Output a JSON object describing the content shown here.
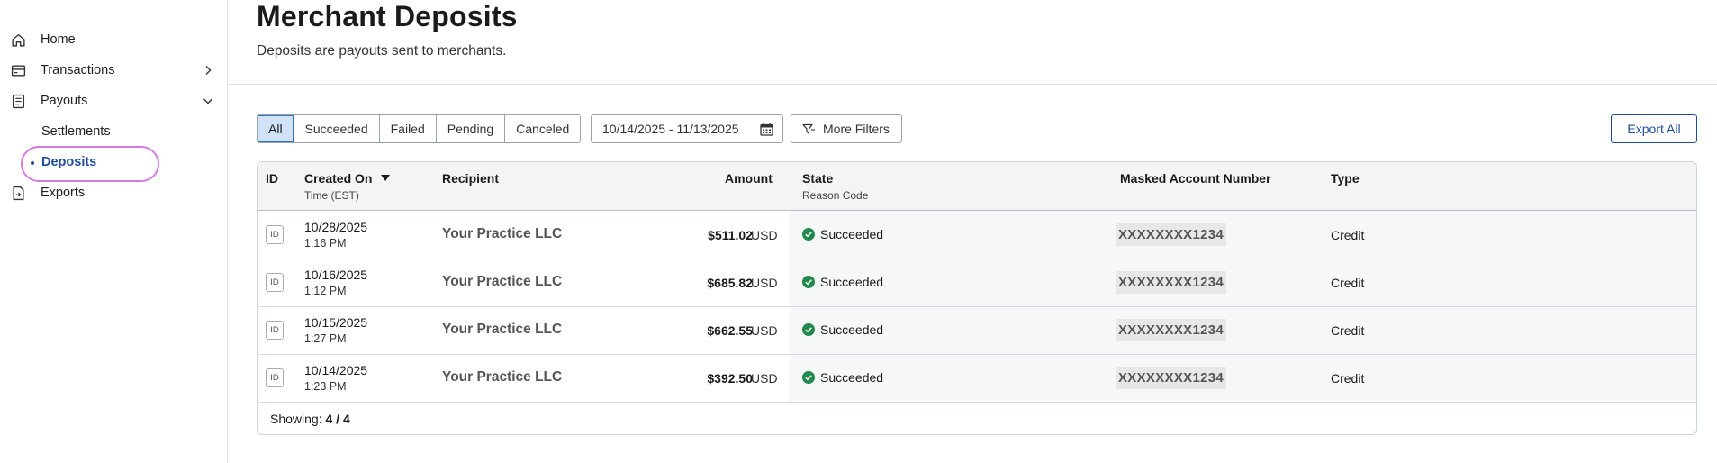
{
  "sidebar": {
    "items": [
      {
        "label": "Home",
        "icon": "home-icon"
      },
      {
        "label": "Transactions",
        "icon": "credit-card-icon",
        "chevron": "chevron-right-icon"
      },
      {
        "label": "Payouts",
        "icon": "receipt-icon",
        "chevron": "chevron-down-icon"
      },
      {
        "label": "Settlements"
      },
      {
        "label": "Deposits",
        "active": true
      },
      {
        "label": "Exports",
        "icon": "file-export-icon"
      }
    ]
  },
  "header": {
    "title": "Merchant Deposits",
    "subtitle": "Deposits are payouts sent to merchants."
  },
  "filters": {
    "status_tabs": [
      "All",
      "Succeeded",
      "Failed",
      "Pending",
      "Canceled"
    ],
    "active_tab": "All",
    "date_range": "10/14/2025 - 11/13/2025",
    "more_filters_label": "More Filters",
    "export_label": "Export All"
  },
  "table": {
    "columns": {
      "id": "ID",
      "created_on": "Created On",
      "created_on_sub": "Time (EST)",
      "recipient": "Recipient",
      "amount": "Amount",
      "state": "State",
      "state_sub": "Reason Code",
      "masked_account": "Masked Account Number",
      "type": "Type"
    },
    "id_badge": "ID",
    "rows": [
      {
        "date": "10/28/2025",
        "time": "1:16 PM",
        "recipient": "Your Practice LLC",
        "amount": "$511.02",
        "currency": "USD",
        "state": "Succeeded",
        "account": "XXXXXXXX1234",
        "type": "Credit"
      },
      {
        "date": "10/16/2025",
        "time": "1:12 PM",
        "recipient": "Your Practice LLC",
        "amount": "$685.82",
        "currency": "USD",
        "state": "Succeeded",
        "account": "XXXXXXXX1234",
        "type": "Credit"
      },
      {
        "date": "10/15/2025",
        "time": "1:27 PM",
        "recipient": "Your Practice LLC",
        "amount": "$662.55",
        "currency": "USD",
        "state": "Succeeded",
        "account": "XXXXXXXX1234",
        "type": "Credit"
      },
      {
        "date": "10/14/2025",
        "time": "1:23 PM",
        "recipient": "Your Practice LLC",
        "amount": "$392.50",
        "currency": "USD",
        "state": "Succeeded",
        "account": "XXXXXXXX1234",
        "type": "Credit"
      }
    ],
    "footer_label": "Showing:",
    "footer_count": "4 / 4"
  },
  "colors": {
    "accent": "#1f4e9c",
    "success": "#1f8a4c",
    "highlight_ring": "#d47ae2"
  }
}
